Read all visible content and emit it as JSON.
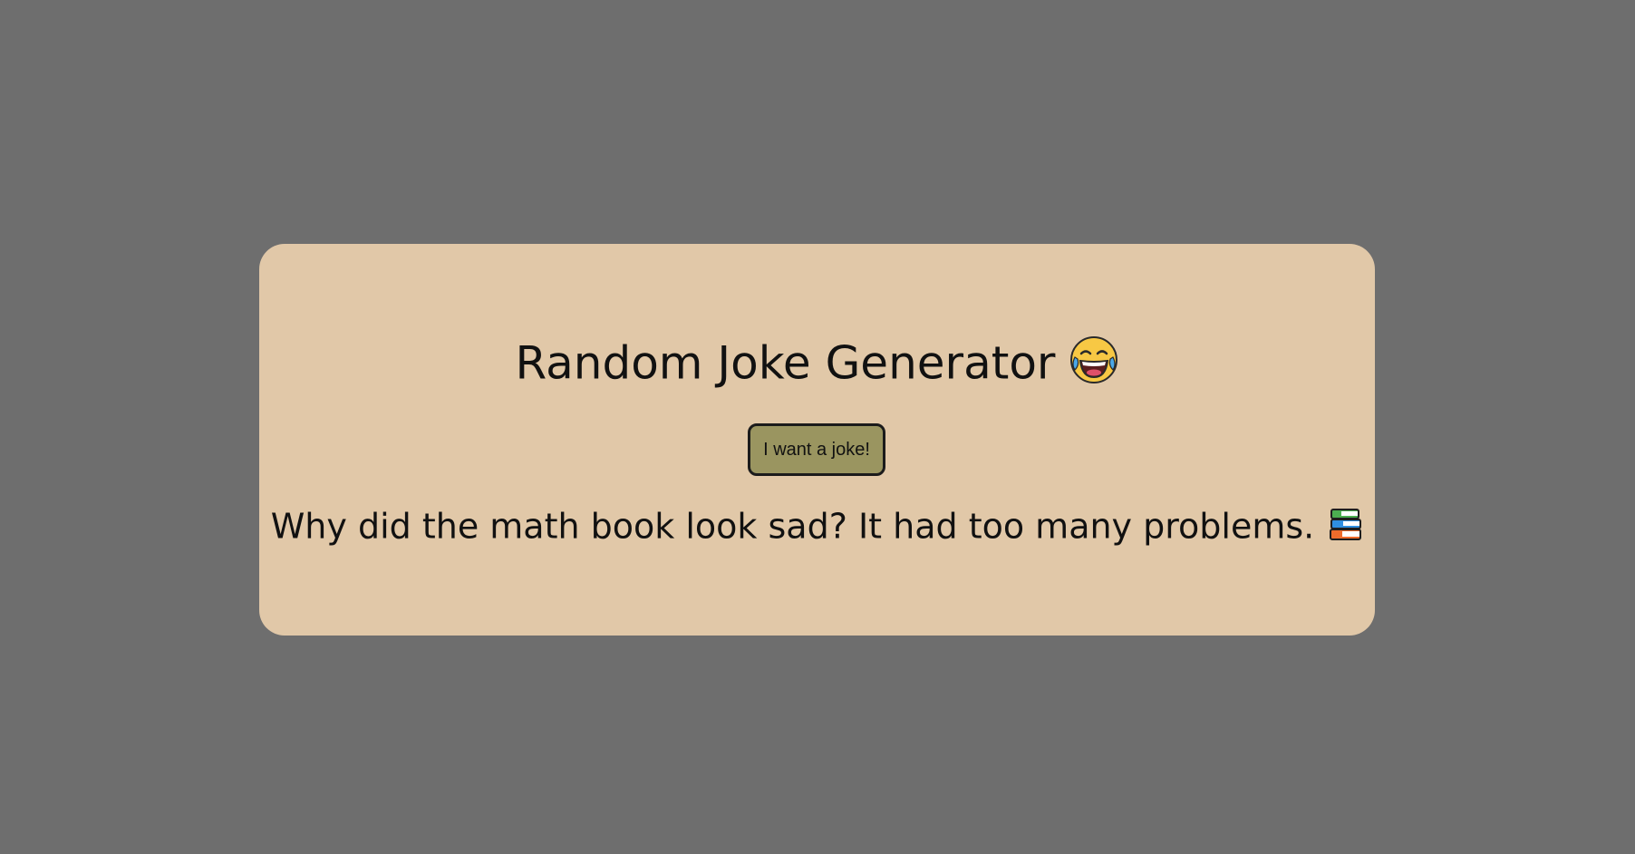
{
  "app": {
    "title": "Random Joke Generator",
    "title_icon": "face-with-tears-of-joy-emoji",
    "button_label": "I want a joke!",
    "joke_text": "Why did the math book look sad? It had too many problems.",
    "joke_icon": "books-emoji"
  },
  "colors": {
    "background": "#6e6e6e",
    "card": "#e1c8a8",
    "button": "#9a9560",
    "text": "#111111"
  }
}
